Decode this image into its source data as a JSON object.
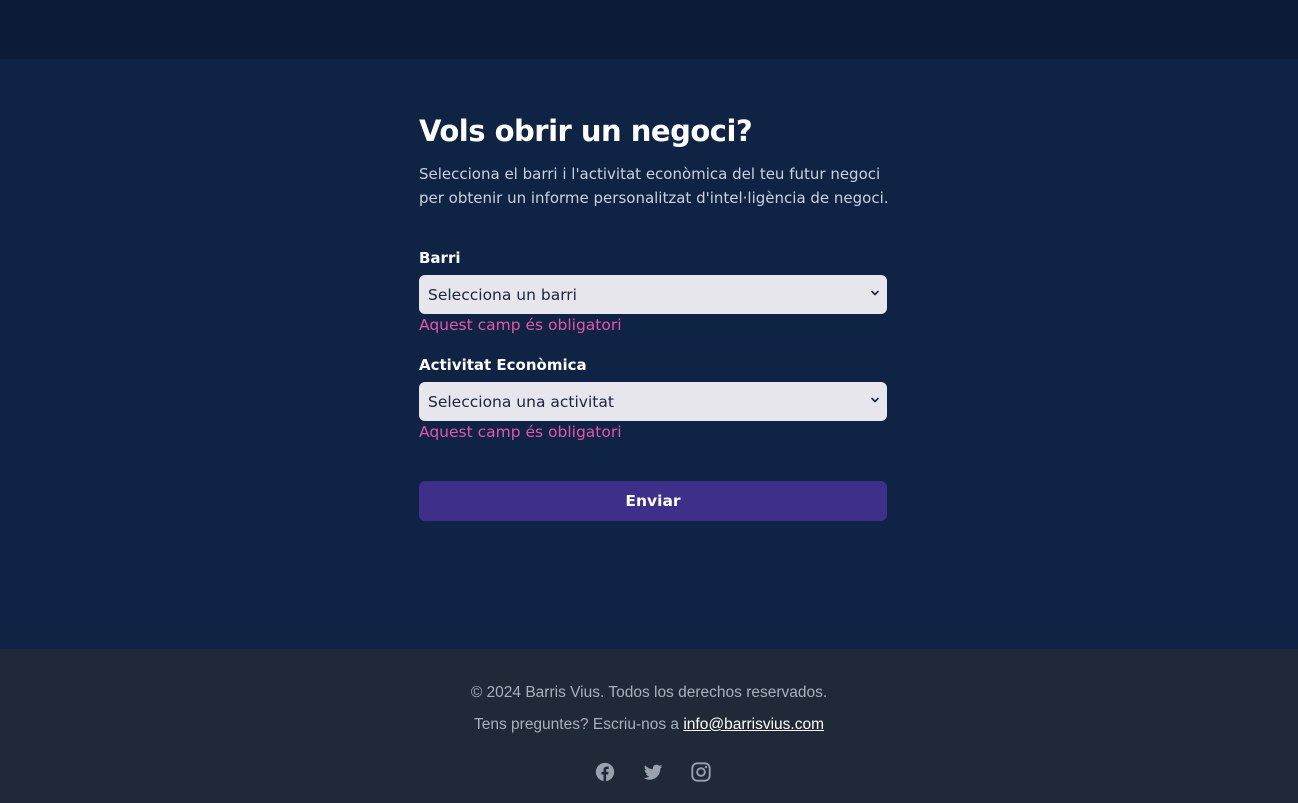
{
  "form": {
    "title": "Vols obrir un negoci?",
    "description": "Selecciona el barri i l'activitat econòmica del teu futur negoci per obtenir un informe personalitzat d'intel·ligència de negoci.",
    "barri": {
      "label": "Barri",
      "selected": "Selecciona un barri",
      "error": "Aquest camp és obligatori"
    },
    "activitat": {
      "label": "Activitat Econòmica",
      "selected": "Selecciona una activitat",
      "error": "Aquest camp és obligatori"
    },
    "submit_label": "Enviar"
  },
  "footer": {
    "copyright": "© 2024 Barris Vius. Todos los derechos reservados.",
    "contact_prefix": "Tens preguntes? Escriu-nos a ",
    "contact_email": "info@barrisvius.com",
    "social_icons": [
      "facebook-icon",
      "twitter-icon",
      "instagram-icon"
    ]
  },
  "colors": {
    "background": "#0f2344",
    "header": "#0c1c36",
    "footer": "#202937",
    "button": "#3d2f8a",
    "error": "#e456a9",
    "select_bg": "#e8e6ed"
  }
}
